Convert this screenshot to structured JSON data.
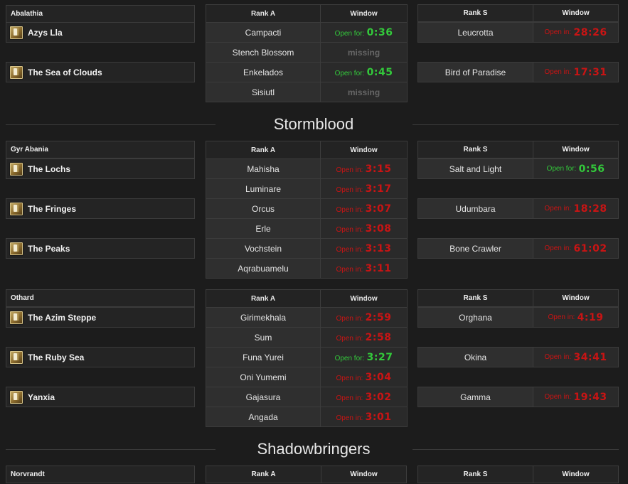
{
  "headers": {
    "rank_a": "Rank A",
    "rank_s": "Rank S",
    "window": "Window"
  },
  "expansions": [
    {
      "title": "Stormblood"
    },
    {
      "title": "Shadowbringers"
    }
  ],
  "regions": [
    {
      "name": "Abalathia",
      "zones": [
        "Azys Lla",
        "The Sea of Clouds"
      ],
      "rank_a": [
        {
          "name": "Campacti",
          "label": "Open for:",
          "time": "0:36",
          "status": "open"
        },
        {
          "name": "Stench Blossom",
          "label": "missing",
          "time": "",
          "status": "missing"
        },
        {
          "name": "Enkelados",
          "label": "Open for:",
          "time": "0:45",
          "status": "open"
        },
        {
          "name": "Sisiutl",
          "label": "missing",
          "time": "",
          "status": "missing"
        }
      ],
      "rank_s": [
        {
          "name": "Leucrotta",
          "label": "Open in:",
          "time": "28:26",
          "status": "closed"
        },
        {
          "name": "Bird of Paradise",
          "label": "Open in:",
          "time": "17:31",
          "status": "closed"
        }
      ]
    },
    {
      "name": "Gyr Abania",
      "zones": [
        "The Lochs",
        "The Fringes",
        "The Peaks"
      ],
      "rank_a": [
        {
          "name": "Mahisha",
          "label": "Open in:",
          "time": "3:15",
          "status": "closed"
        },
        {
          "name": "Luminare",
          "label": "Open in:",
          "time": "3:17",
          "status": "closed"
        },
        {
          "name": "Orcus",
          "label": "Open in:",
          "time": "3:07",
          "status": "closed"
        },
        {
          "name": "Erle",
          "label": "Open in:",
          "time": "3:08",
          "status": "closed"
        },
        {
          "name": "Vochstein",
          "label": "Open in:",
          "time": "3:13",
          "status": "closed"
        },
        {
          "name": "Aqrabuamelu",
          "label": "Open in:",
          "time": "3:11",
          "status": "closed"
        }
      ],
      "rank_s": [
        {
          "name": "Salt and Light",
          "label": "Open for:",
          "time": "0:56",
          "status": "open"
        },
        {
          "name": "Udumbara",
          "label": "Open in:",
          "time": "18:28",
          "status": "closed"
        },
        {
          "name": "Bone Crawler",
          "label": "Open in:",
          "time": "61:02",
          "status": "closed"
        }
      ]
    },
    {
      "name": "Othard",
      "zones": [
        "The Azim Steppe",
        "The Ruby Sea",
        "Yanxia"
      ],
      "rank_a": [
        {
          "name": "Girimekhala",
          "label": "Open in:",
          "time": "2:59",
          "status": "closed"
        },
        {
          "name": "Sum",
          "label": "Open in:",
          "time": "2:58",
          "status": "closed"
        },
        {
          "name": "Funa Yurei",
          "label": "Open for:",
          "time": "3:27",
          "status": "open"
        },
        {
          "name": "Oni Yumemi",
          "label": "Open in:",
          "time": "3:04",
          "status": "closed"
        },
        {
          "name": "Gajasura",
          "label": "Open in:",
          "time": "3:02",
          "status": "closed"
        },
        {
          "name": "Angada",
          "label": "Open in:",
          "time": "3:01",
          "status": "closed"
        }
      ],
      "rank_s": [
        {
          "name": "Orghana",
          "label": "Open in:",
          "time": "4:19",
          "status": "closed"
        },
        {
          "name": "Okina",
          "label": "Open in:",
          "time": "34:41",
          "status": "closed"
        },
        {
          "name": "Gamma",
          "label": "Open in:",
          "time": "19:43",
          "status": "closed"
        }
      ]
    },
    {
      "name": "Norvrandt",
      "zones": [],
      "rank_a": [],
      "rank_s": []
    }
  ]
}
